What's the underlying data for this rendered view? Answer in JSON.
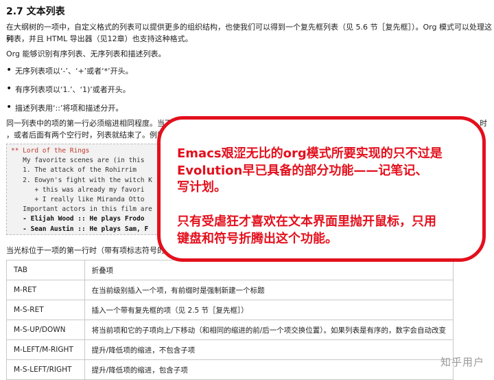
{
  "section": {
    "title": "2.7 文本列表"
  },
  "intro": {
    "line1": "在大纲树的一项中，自定义格式的列表可以提供更多的组织结构，也使我们可以得到一个复先框列表（见 5.6 节［复先框］）。Org 模式可以处理这种",
    "line2": "列表，并且 HTML 导出器（见12章）也支持这种格式。"
  },
  "recognize": "Org 能够识别有序列表、无序列表和描述列表。",
  "bullets": [
    "无序列表项以‘-’、‘+’或者‘*’开头。",
    "有序列表项以‘1.’、‘1)’或者开头。",
    "描述列表用‘::’将项和描述分开。"
  ],
  "indent_para": {
    "line1": "同一列表中的项的第一行必须缩进相同程度。当下一行的缩进小于或等于这一列表第一项的缩进时，或者",
    "line1_tail": "时",
    "line2": "，或者后面有两个空行时，列表就结束了。例如："
  },
  "code": {
    "lines": [
      "** Lord of the Rings",
      "   My favorite scenes are (in this",
      "   1. The attack of the Rohirrim",
      "   2. Eowyn's fight with the witch K",
      "      + this was already my favori",
      "      + I really like Miranda Otto",
      "   Important actors in this film are",
      "   - Elijah Wood :: He plays Frodo",
      "   - Sean Austin :: He plays Sam, F"
    ]
  },
  "cursor_para": "当光标位于一项的第一行时（带有项标志符号的",
  "table": {
    "rows": [
      {
        "key": "TAB",
        "desc": "折叠项"
      },
      {
        "key": "M-RET",
        "desc": "在当前级别插入一个项，有前缀时是强制新建一个标题"
      },
      {
        "key": "M-S-RET",
        "desc": "插入一个带有复先框的项（见 2.5 节［复先框］）"
      },
      {
        "key": "M-S-UP/DOWN",
        "desc": "将当前项和它的子项向上/下移动（和相同的缩进的前/后一个项交换位置）。如果列表是有序的，数字会自动改变"
      },
      {
        "key": "M-LEFT/M-RIGHT",
        "desc": "提升/降低项的缩进，不包含子项"
      },
      {
        "key": "M-S-LEFT/RIGHT",
        "desc": "提升/降低项的缩进，包含子项"
      }
    ]
  },
  "overlay": {
    "para1": [
      "Emacs艰涩无比的org模式所要实现的只不过是",
      "Evolution早已具备的部分功能——记笔记、",
      "写计划。"
    ],
    "para2": [
      "只有受虐狂才喜欢在文本界面里抛开鼠标，只用",
      "键盘和符号折腾出这个功能。"
    ],
    "color": "#e3101d"
  },
  "watermark": "知乎用户"
}
